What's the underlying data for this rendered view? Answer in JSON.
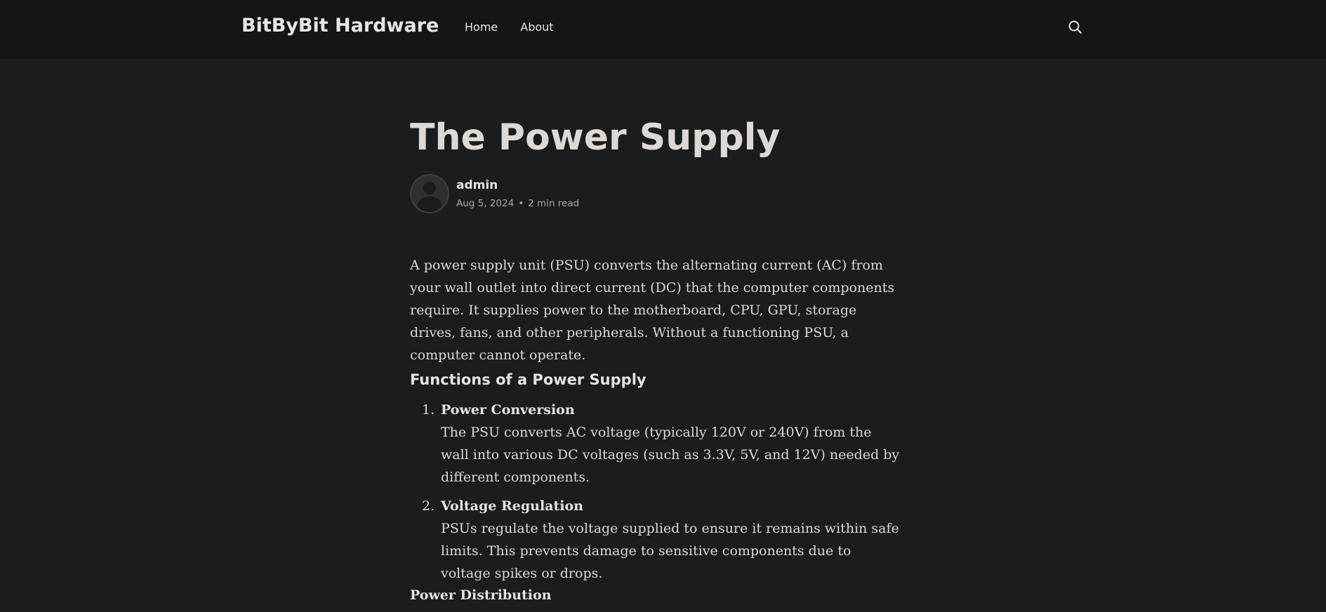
{
  "header": {
    "site_title": "BitByBit Hardware",
    "nav": [
      {
        "label": "Home"
      },
      {
        "label": "About"
      }
    ],
    "search_icon": "search-icon"
  },
  "post": {
    "title": "The Power Supply",
    "author": "admin",
    "avatar_icon": "user-avatar-icon",
    "date": "Aug 5, 2024",
    "separator": "•",
    "read_time": "2 min read",
    "intro": "A power supply unit (PSU) converts the alternating current (AC) from your wall outlet into direct current (DC) that the computer components require. It supplies power to the motherboard, CPU, GPU, storage drives, fans, and other peripherals. Without a functioning PSU, a computer cannot operate.",
    "functions_heading": "Functions of a Power Supply",
    "functions": [
      {
        "number": "1.",
        "title": "Power Conversion",
        "description": "The PSU converts AC voltage (typically 120V or 240V) from the wall into various DC voltages (such as 3.3V, 5V, and 12V) needed by different components."
      },
      {
        "number": "2.",
        "title": "Voltage Regulation",
        "description": "PSUs regulate the voltage supplied to ensure it remains within safe limits. This prevents damage to sensitive components due to voltage spikes or drops."
      }
    ],
    "next_heading": "Power Distribution"
  },
  "colors": {
    "background": "#1b1c1e",
    "header_background": "#141517",
    "title_text": "#dcd8d4",
    "body_text": "#d9d9d9",
    "meta_text": "#a8a8a8"
  }
}
